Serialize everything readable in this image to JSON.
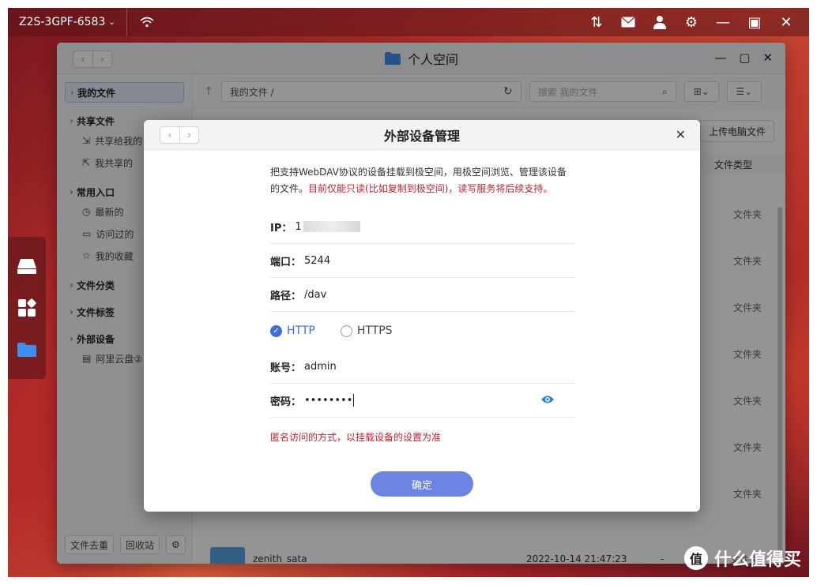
{
  "topbar": {
    "device_name": "Z2S-3GPF-6583",
    "icons": [
      "transfer-icon",
      "mail-icon",
      "user-icon",
      "gear-icon",
      "minimize-icon",
      "maximize-icon",
      "close-icon"
    ]
  },
  "window": {
    "title": "个人空间"
  },
  "sidebar": {
    "my_files": "我的文件",
    "shared": "共享文件",
    "shared_to_me": "共享给我的",
    "my_shares": "我共享的",
    "common_entry": "常用入口",
    "recent": "最新的",
    "visited": "访问过的",
    "favorites": "我的收藏",
    "categories": "文件分类",
    "tags": "文件标签",
    "external": "外部设备",
    "aliyun": "阿里云盘②",
    "dedup": "文件去重",
    "recycle": "回收站"
  },
  "main": {
    "path": "我的文件 /",
    "search_placeholder": "搜索 我的文件",
    "upload": "上传电脑文件",
    "col_type": "文件类型",
    "type_folder": "文件夹",
    "last_row": {
      "name": "zenith_sata",
      "date": "2022-10-14 21:47:23",
      "size": "-",
      "type": "文件夹"
    }
  },
  "dialog": {
    "title": "外部设备管理",
    "desc_normal": "把支持WebDAV协议的设备挂载到极空间，用极空间浏览、管理该设备的文件。",
    "desc_warn": "目前仅能只读(比如复制到极空间)，读写服务将后续支持。",
    "ip_label": "IP：",
    "ip_value": "1",
    "port_label": "端口：",
    "port_value": "5244",
    "path_label": "路径：",
    "path_value": "/dav",
    "http": "HTTP",
    "https": "HTTPS",
    "account_label": "账号：",
    "account_value": "admin",
    "password_label": "密码：",
    "password_value": "••••••••",
    "hint": "匿名访问的方式，以挂载设备的设置为准",
    "confirm": "确定"
  },
  "watermark": {
    "logo": "值",
    "text": "什么值得买"
  }
}
